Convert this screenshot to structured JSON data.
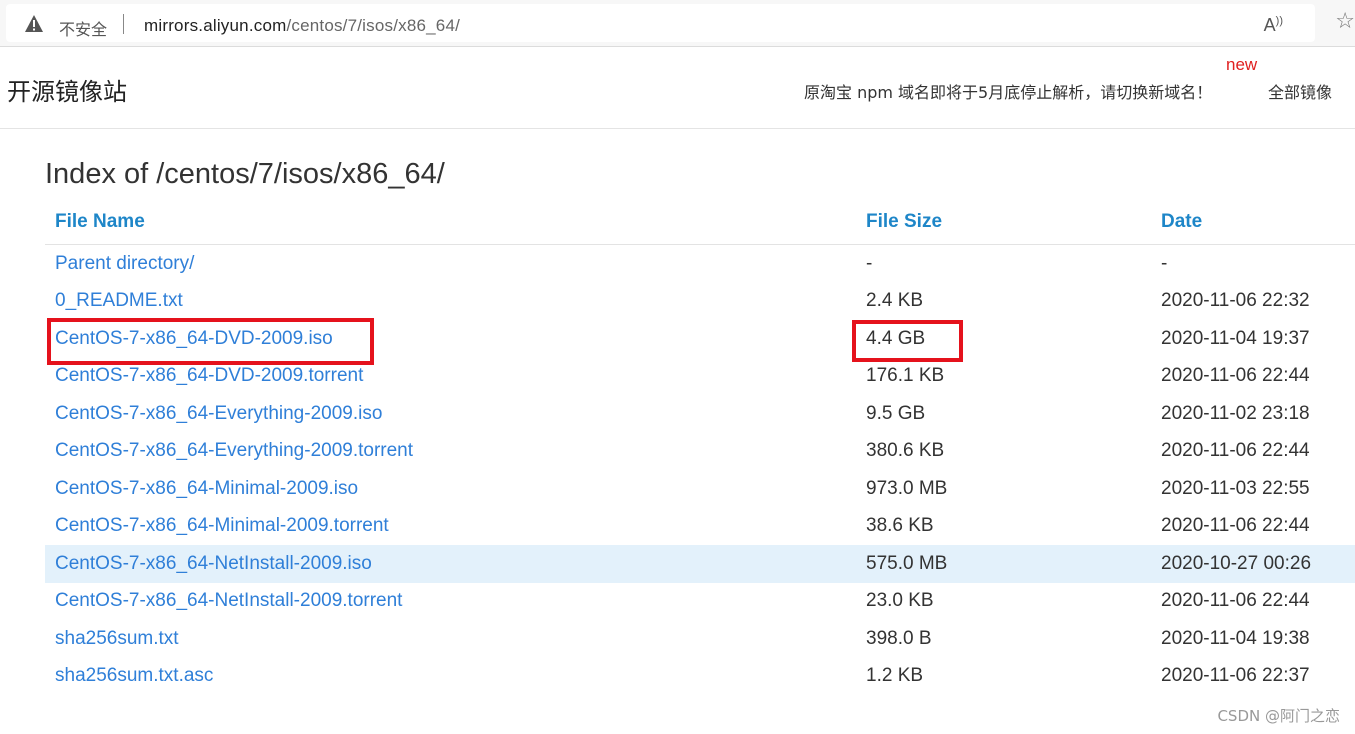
{
  "browser": {
    "security_label": "不安全",
    "url_host": "mirrors.aliyun.com",
    "url_path": "/centos/7/isos/x86_64/",
    "read_aloud_icon": "read-aloud-icon",
    "favorite_icon": "star-icon"
  },
  "header": {
    "logo": "开源镜像站",
    "notice": "原淘宝 npm 域名即将于5月底停止解析，请切换新域名！",
    "new_badge": "new",
    "all_mirrors": "全部镜像"
  },
  "listing": {
    "title": "Index of /centos/7/isos/x86_64/",
    "columns": [
      "File Name",
      "File Size",
      "Date"
    ],
    "rows": [
      {
        "name": "Parent directory/",
        "size": "-",
        "date": "-"
      },
      {
        "name": "0_README.txt",
        "size": "2.4 KB",
        "date": "2020-11-06 22:32"
      },
      {
        "name": "CentOS-7-x86_64-DVD-2009.iso",
        "size": "4.4 GB",
        "date": "2020-11-04 19:37"
      },
      {
        "name": "CentOS-7-x86_64-DVD-2009.torrent",
        "size": "176.1 KB",
        "date": "2020-11-06 22:44"
      },
      {
        "name": "CentOS-7-x86_64-Everything-2009.iso",
        "size": "9.5 GB",
        "date": "2020-11-02 23:18"
      },
      {
        "name": "CentOS-7-x86_64-Everything-2009.torrent",
        "size": "380.6 KB",
        "date": "2020-11-06 22:44"
      },
      {
        "name": "CentOS-7-x86_64-Minimal-2009.iso",
        "size": "973.0 MB",
        "date": "2020-11-03 22:55"
      },
      {
        "name": "CentOS-7-x86_64-Minimal-2009.torrent",
        "size": "38.6 KB",
        "date": "2020-11-06 22:44"
      },
      {
        "name": "CentOS-7-x86_64-NetInstall-2009.iso",
        "size": "575.0 MB",
        "date": "2020-10-27 00:26"
      },
      {
        "name": "CentOS-7-x86_64-NetInstall-2009.torrent",
        "size": "23.0 KB",
        "date": "2020-11-06 22:44"
      },
      {
        "name": "sha256sum.txt",
        "size": "398.0 B",
        "date": "2020-11-04 19:38"
      },
      {
        "name": "sha256sum.txt.asc",
        "size": "1.2 KB",
        "date": "2020-11-06 22:37"
      }
    ],
    "highlighted_row": 8
  },
  "watermark": "CSDN @阿门之恋",
  "colors": {
    "link": "#2f7fd8",
    "header_link": "#1e86c8",
    "annotation_red": "#e5121c",
    "row_highlight": "#e3f1fb"
  }
}
